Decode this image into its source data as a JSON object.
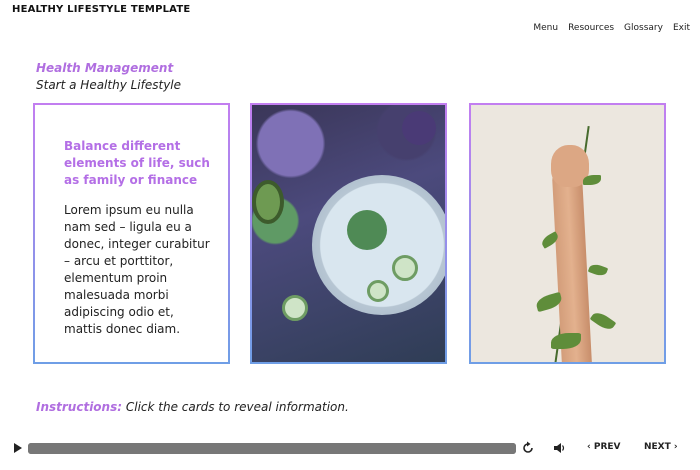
{
  "header": {
    "title": "HEALTHY LIFESTYLE TEMPLATE",
    "nav": [
      "Menu",
      "Resources",
      "Glossary",
      "Exit"
    ]
  },
  "section": {
    "title": "Health Management",
    "subtitle": "Start a Healthy Lifestyle"
  },
  "cards": [
    {
      "heading": "Balance different elements of life, such as family or finance",
      "body": "Lorem ipsum eu nulla nam sed – ligula eu a donec, integer curabitur – arcu et porttitor, elementum proin malesuada morbi adipiscing odio et, mattis donec diam."
    },
    {
      "image": "food-photo"
    },
    {
      "image": "plant-hand-photo"
    }
  ],
  "instructions": {
    "label": "Instructions:",
    "text": " Click the cards to reveal information."
  },
  "player": {
    "prev_label": "PREV",
    "next_label": "NEXT",
    "prev_glyph": "‹",
    "next_glyph": "›",
    "progress": 1.0
  },
  "colors": {
    "accent": "#b06ee0",
    "card_border_top": "#c27ef0",
    "card_border_bottom": "#6f9ee6"
  }
}
